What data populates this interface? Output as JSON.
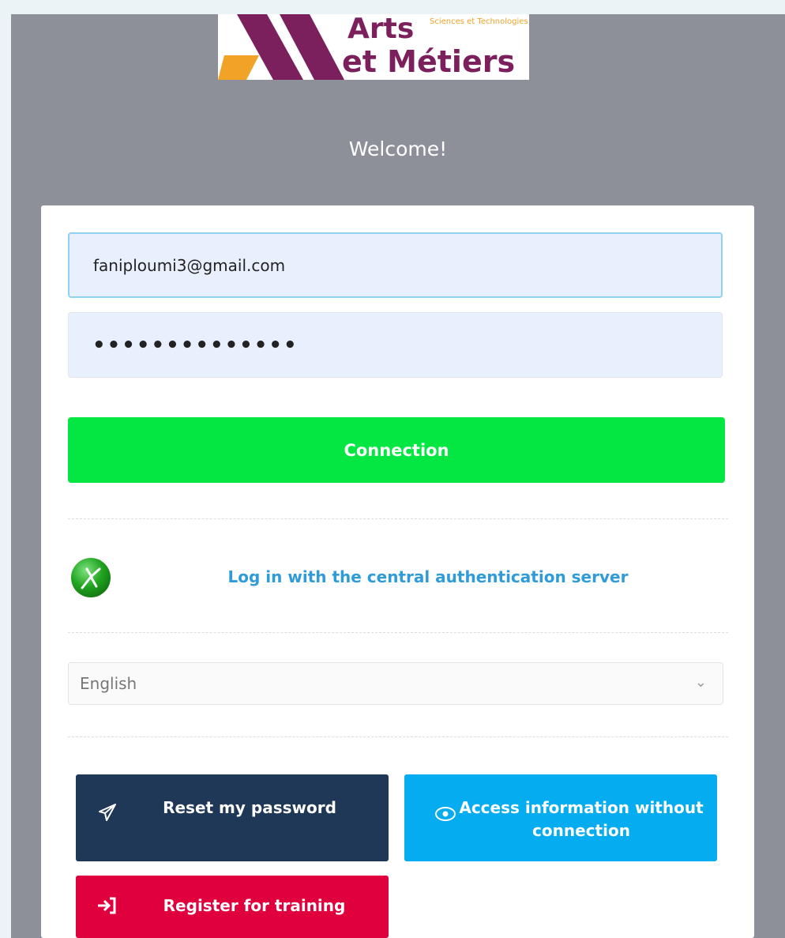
{
  "logo": {
    "line1": "Arts",
    "line2": "et Métiers",
    "tagline": "Sciences et Technologies",
    "colors": {
      "brand": "#7b1f5d",
      "accent": "#f0a326"
    }
  },
  "welcome": "Welcome!",
  "form": {
    "email_value": "faniploumi3@gmail.com",
    "password_mask": "••••••••••••••",
    "connect_label": "Connection"
  },
  "cas": {
    "icon": "cas-server-icon",
    "link_label": "Log in with the central authentication server"
  },
  "language": {
    "selected": "English",
    "icon": "chevron-down-icon"
  },
  "actions": {
    "reset": {
      "label": "Reset my password",
      "icon": "paper-plane-icon",
      "color": "#1f3857"
    },
    "access": {
      "label_line1": "Access information without",
      "label_line2": "connection",
      "icon": "eye-icon",
      "color": "#05acef"
    },
    "register": {
      "label": "Register for training",
      "icon": "sign-in-icon",
      "color": "#e0003e"
    }
  },
  "colors": {
    "connect": "#04e641",
    "link": "#2f9bd8",
    "background": "#8e9099"
  }
}
